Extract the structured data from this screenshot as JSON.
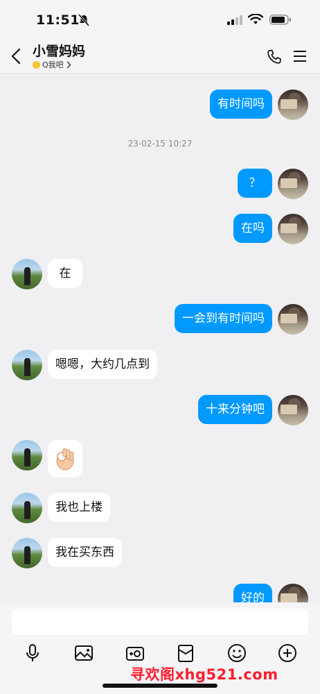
{
  "status_bar": {
    "time": "11:51"
  },
  "header": {
    "contact_name": "小雪妈妈",
    "subtitle": "Q我吧"
  },
  "messages": [
    {
      "from": "me",
      "text": "有时间吗"
    },
    {
      "type": "timestamp",
      "text": "23-02-15 10:27"
    },
    {
      "from": "me",
      "text": "？"
    },
    {
      "from": "me",
      "text": "在吗"
    },
    {
      "from": "other",
      "text": "在"
    },
    {
      "from": "me",
      "text": "一会到有时间吗"
    },
    {
      "from": "other",
      "text": "嗯嗯，大约几点到"
    },
    {
      "from": "me",
      "text": "十来分钟吧"
    },
    {
      "from": "other",
      "text": "👌"
    },
    {
      "from": "other",
      "text": "我也上楼"
    },
    {
      "from": "other",
      "text": "我在买东西"
    },
    {
      "from": "me",
      "text": "好的"
    }
  ],
  "input": {
    "placeholder": ""
  },
  "toolbar": [
    "mic-icon",
    "image-icon",
    "camera-icon",
    "red-packet-icon",
    "emoji-icon",
    "plus-icon"
  ],
  "watermark": "寻欢阁xhg521.com",
  "colors": {
    "sent_bubble": "#0099ff",
    "received_bubble": "#ffffff",
    "background": "#f0f0f2"
  }
}
